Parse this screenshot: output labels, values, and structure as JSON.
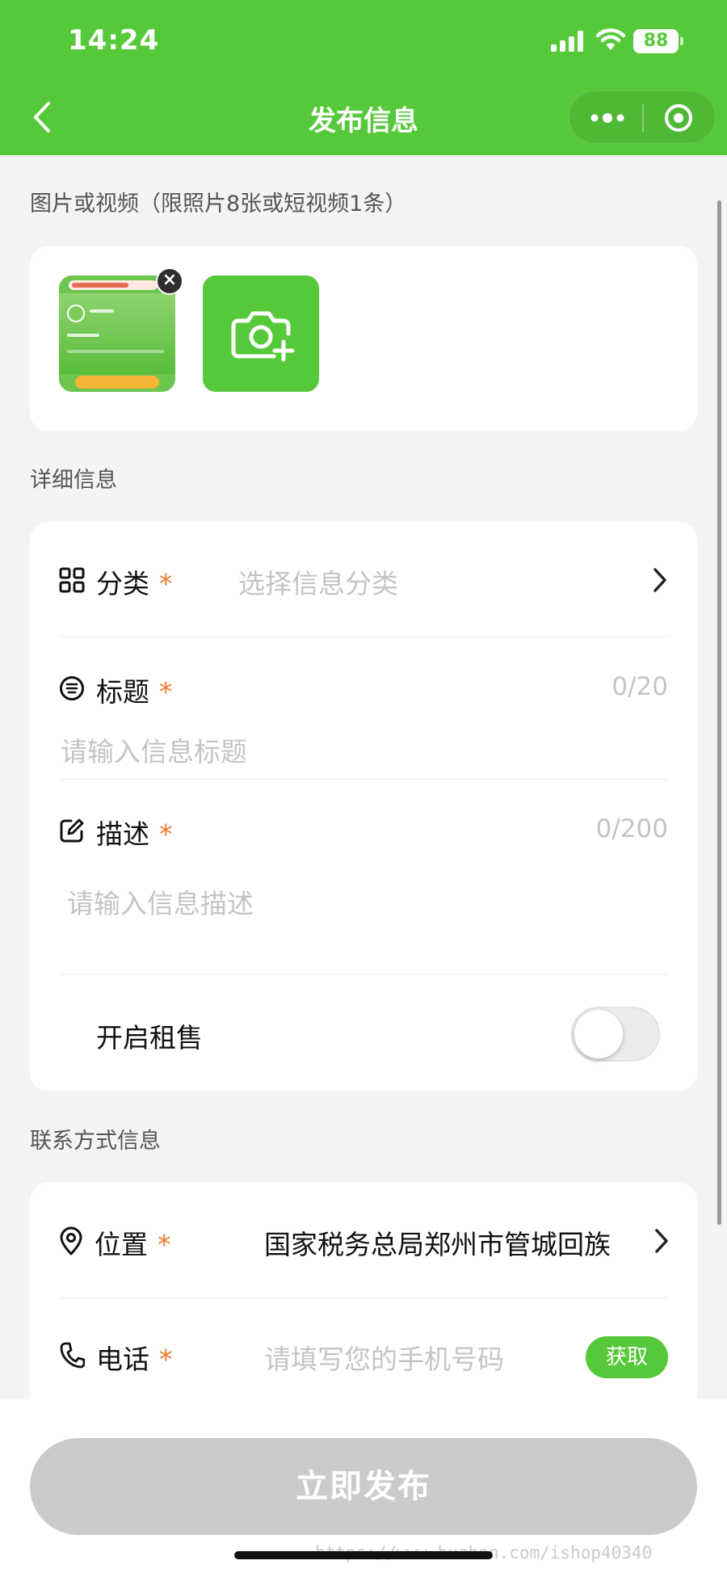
{
  "status_bar": {
    "time": "14:24",
    "battery": "88"
  },
  "nav": {
    "title": "发布信息"
  },
  "media_section": {
    "label": "图片或视频（限照片8张或短视频1条）"
  },
  "details_section": {
    "label": "详细信息",
    "category": {
      "label": "分类",
      "required": "*",
      "placeholder": "选择信息分类"
    },
    "title": {
      "label": "标题",
      "required": "*",
      "counter": "0/20",
      "placeholder": "请输入信息标题"
    },
    "description": {
      "label": "描述",
      "required": "*",
      "counter": "0/200",
      "placeholder": "请输入信息描述"
    },
    "rental": {
      "label": "开启租售",
      "enabled": false
    }
  },
  "contact_section": {
    "label": "联系方式信息",
    "location": {
      "label": "位置",
      "required": "*",
      "value": "国家税务总局郑州市管城回族"
    },
    "phone": {
      "label": "电话",
      "required": "*",
      "placeholder": "请填写您的手机号码",
      "get_button": "获取"
    }
  },
  "footer": {
    "publish_button": "立即发布",
    "watermark": "https://www.huzhan.com/ishop40340"
  },
  "colors": {
    "brand_green": "#56c93a",
    "required_star": "#ef7a2c",
    "disabled_button": "#cbcbcb"
  }
}
